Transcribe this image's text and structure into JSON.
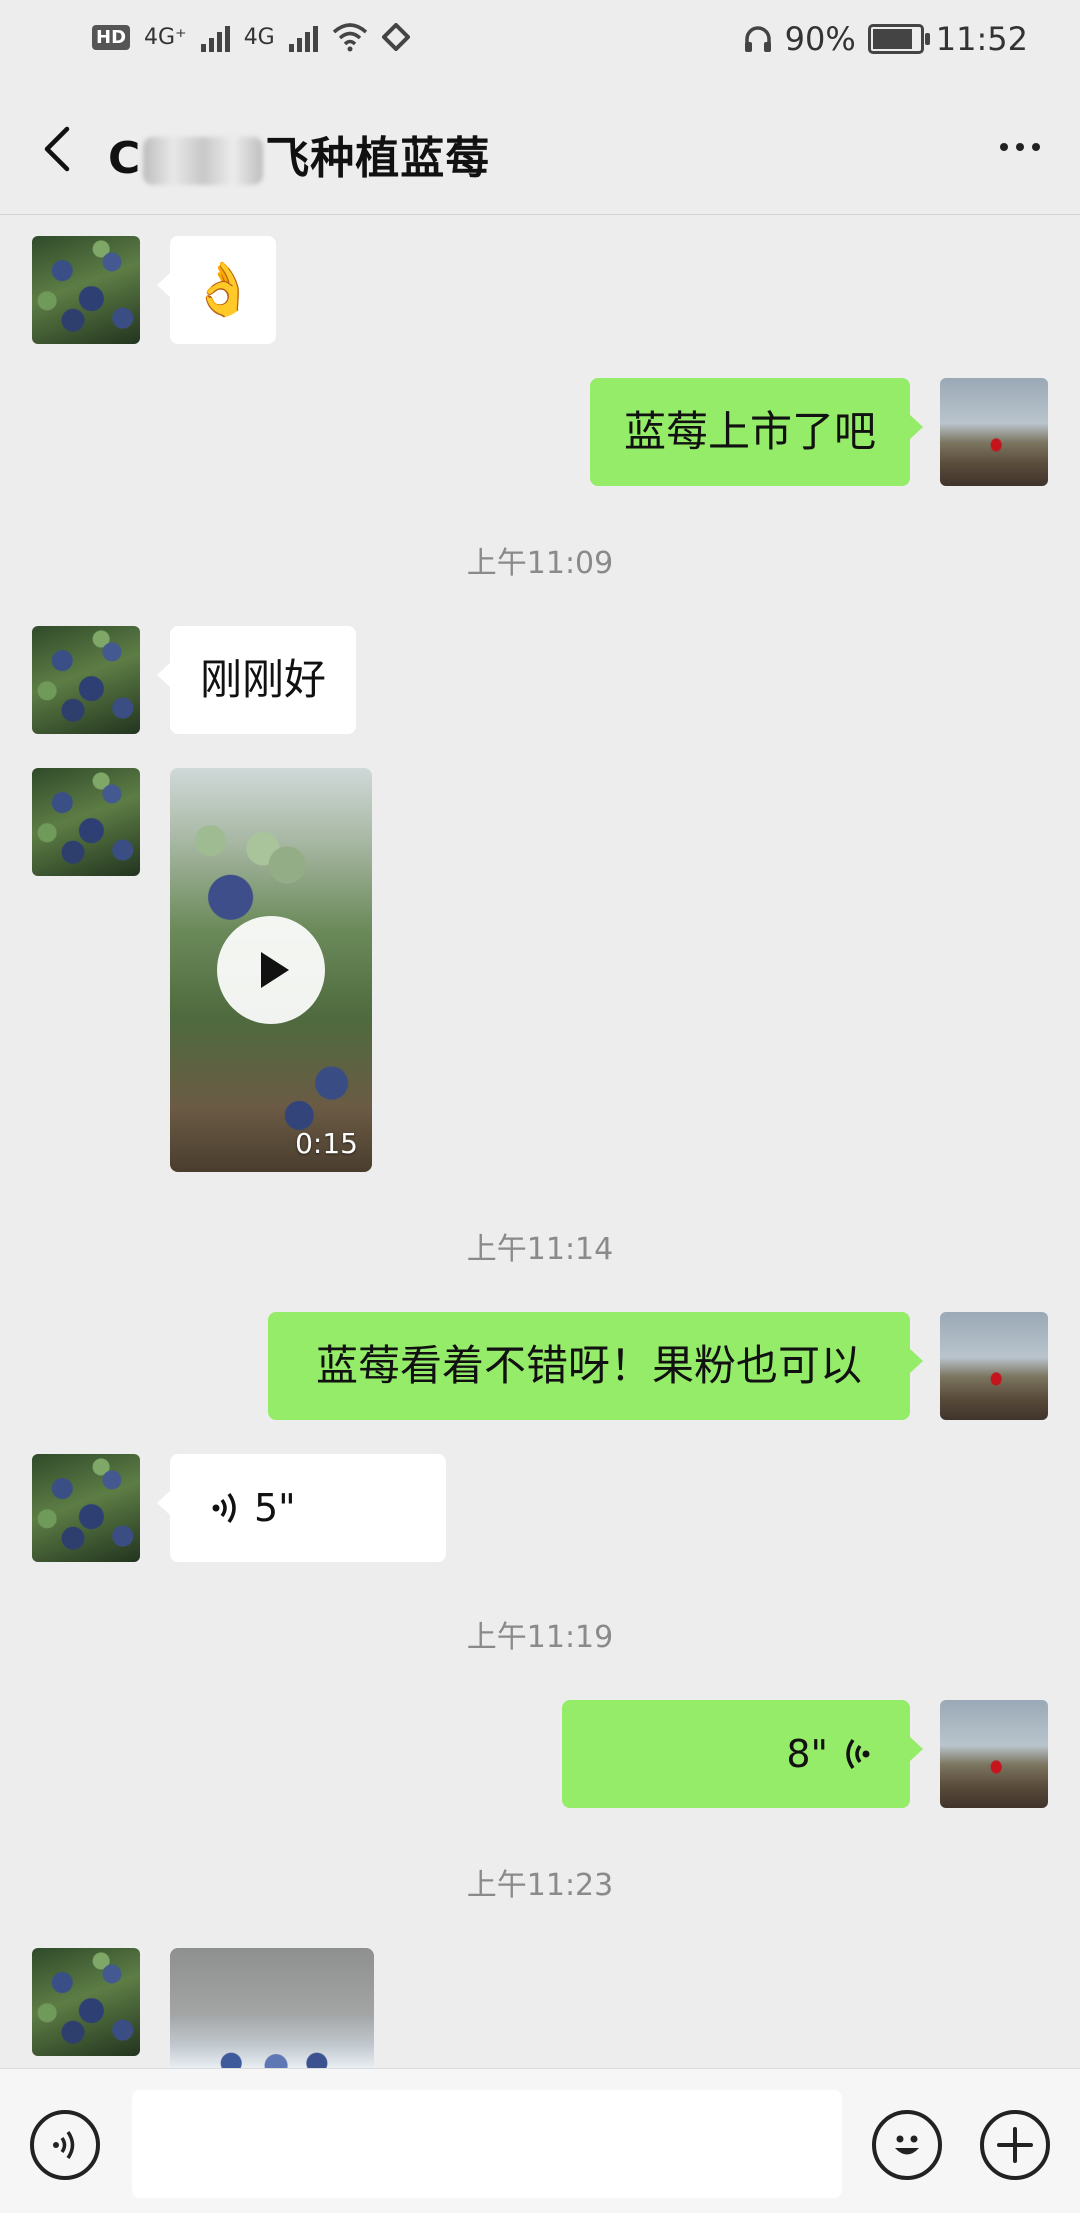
{
  "status_bar": {
    "hd": "HD",
    "sim1_net": "4G⁺",
    "sim2_net": "4G",
    "battery": "90%",
    "battery_level": 0.9,
    "time": "11:52"
  },
  "header": {
    "title_prefix": "C",
    "title_suffix": "飞种植蓝莓"
  },
  "messages": {
    "m1_emoji": "👌",
    "m2_text": "蓝莓上市了吧",
    "t1": "上午11:09",
    "m3_text": "刚刚好",
    "m4_video_duration": "0:15",
    "t2": "上午11:14",
    "m5_text": "蓝莓看着不错呀！果粉也可以",
    "m6_voice": "5\"",
    "t3": "上午11:19",
    "m7_voice": "8\"",
    "t4": "上午11:23"
  },
  "icons": {
    "back": "chevron-left-icon",
    "more": "more-dots-icon",
    "voice_input": "voice-input-icon",
    "emoji": "emoji-icon",
    "add": "plus-icon"
  },
  "colors": {
    "background": "#ededed",
    "sent_bubble": "#95ec69",
    "received_bubble": "#ffffff"
  }
}
